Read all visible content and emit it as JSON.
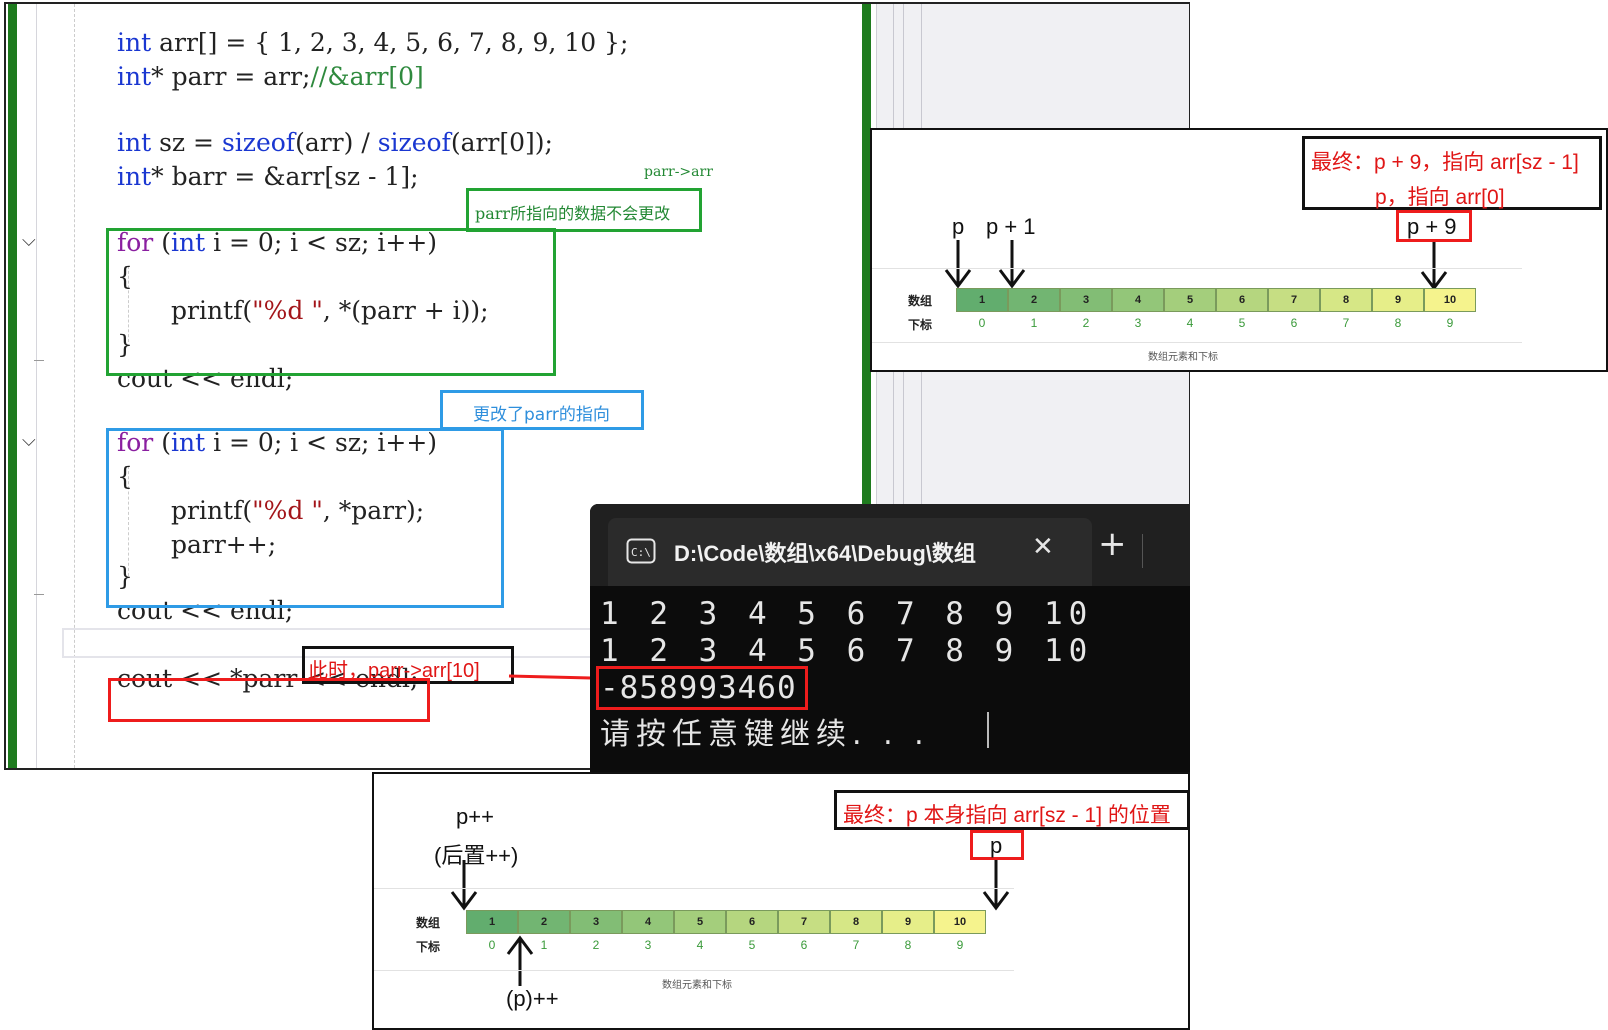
{
  "editor": {
    "lines": {
      "l1": [
        "int",
        " arr[] = { 1, 2, 3, 4, 5, 6, 7, 8, 9, 10 };"
      ],
      "l2": [
        "int",
        "* parr = arr;",
        "//&arr[0]"
      ],
      "l3": [
        "int",
        " sz = ",
        "sizeof",
        "(arr) / ",
        "sizeof",
        "(arr[0]);"
      ],
      "l4": [
        "int",
        "* barr = &arr[sz - 1];"
      ],
      "l5": [
        "for",
        " (",
        "int",
        " i = 0; i < sz; i++)"
      ],
      "l6": "{",
      "l7": [
        "printf(",
        "\"%d \"",
        ", *(parr + i));"
      ],
      "l8": "}",
      "l9": "cout << endl;",
      "l10": [
        "for",
        " (",
        "int",
        " i = 0; i < sz; i++)"
      ],
      "l11": "{",
      "l12": [
        "printf(",
        "\"%d \"",
        ", *parr);"
      ],
      "l13": "parr++;",
      "l14": "}",
      "l15": "cout << endl;",
      "l16": "cout << *parr << endl;"
    },
    "annotations": {
      "parr_arrow": "parr->arr",
      "green_note": "parr所指向的数据不会更改",
      "blue_note": "更改了parr的指向",
      "black_note": "此时，parr->arr[10]"
    },
    "fold_glyph": "⌵"
  },
  "console": {
    "tab_title": "D:\\Code\\数组\\x64\\Debug\\数组",
    "close_glyph": "✕",
    "new_tab_glyph": "+",
    "lines": [
      "1 2 3 4 5 6 7 8 9 10",
      "1 2 3 4 5 6 7 8 9 10",
      "-858993460",
      "请按任意键继续. . ."
    ]
  },
  "diagram_top": {
    "note_line1": "最终：p + 9，指向 arr[sz - 1]",
    "note_line2": "p，指向 arr[0]",
    "pointer_labels": [
      "p",
      "p + 1",
      "p + 9"
    ],
    "row_label_values": "数组",
    "row_label_index": "下标",
    "values": [
      "1",
      "2",
      "3",
      "4",
      "5",
      "6",
      "7",
      "8",
      "9",
      "10"
    ],
    "indices": [
      "0",
      "1",
      "2",
      "3",
      "4",
      "5",
      "6",
      "7",
      "8",
      "9"
    ],
    "caption": "数组元素和下标"
  },
  "diagram_bottom": {
    "note": "最终：p 本身指向 arr[sz - 1] 的位置",
    "pointer_p_end": "p",
    "pointer_pp": "p++",
    "pointer_pp_sub": "(后置++)",
    "pointer_paren": "(p)++",
    "row_label_values": "数组",
    "row_label_index": "下标",
    "values": [
      "1",
      "2",
      "3",
      "4",
      "5",
      "6",
      "7",
      "8",
      "9",
      "10"
    ],
    "indices": [
      "0",
      "1",
      "2",
      "3",
      "4",
      "5",
      "6",
      "7",
      "8",
      "9"
    ],
    "caption": "数组元素和下标"
  },
  "colors": {
    "cells": [
      "#62ad6e",
      "#72b572",
      "#82bd75",
      "#93c679",
      "#a4ce7c",
      "#b5d67f",
      "#c6de83",
      "#d6e786",
      "#e6ee89",
      "#f5f38d"
    ],
    "red": "#ee1c1c",
    "green": "#22a333",
    "blue": "#2f9be6"
  }
}
